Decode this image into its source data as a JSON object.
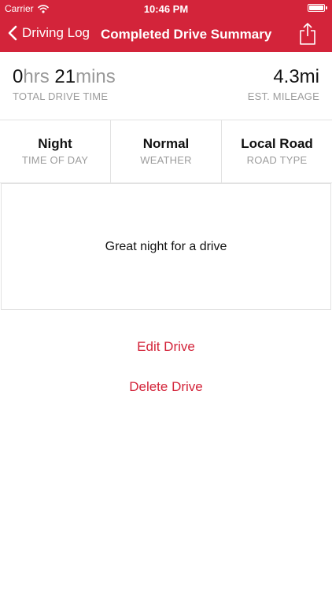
{
  "status_bar": {
    "carrier": "Carrier",
    "time": "10:46 PM",
    "battery_level": 1.0
  },
  "nav": {
    "back_label": "Driving Log",
    "title": "Completed Drive Summary",
    "share_icon": "share-icon"
  },
  "summary": {
    "hours_value": "0",
    "hours_unit": "hrs",
    "minutes_value": "21",
    "minutes_unit": "mins",
    "drive_time_label": "TOTAL DRIVE TIME",
    "mileage": "4.3mi",
    "mileage_label": "EST. MILEAGE"
  },
  "conditions": [
    {
      "value": "Night",
      "label": "TIME OF DAY"
    },
    {
      "value": "Normal",
      "label": "WEATHER"
    },
    {
      "value": "Local Road",
      "label": "ROAD TYPE"
    }
  ],
  "notes": "Great night for a drive",
  "actions": {
    "edit_label": "Edit Drive",
    "delete_label": "Delete Drive"
  },
  "colors": {
    "brand_red": "#d3243a",
    "label_gray": "#9c9c9c"
  }
}
